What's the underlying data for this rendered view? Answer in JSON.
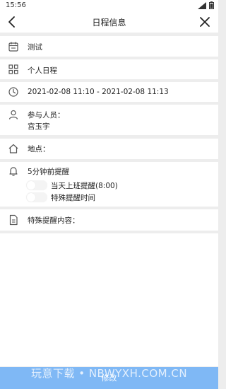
{
  "status_bar": {
    "time": "15:56"
  },
  "nav": {
    "title": "日程信息"
  },
  "schedule": {
    "name": "测试",
    "type": "个人日程",
    "time_range": "2021-02-08 11:10 - 2021-02-08 11:13",
    "participants_label": "参与人员：",
    "participants_value": "宫玉宇",
    "location_label": "地点：",
    "reminder": "5分钟前提醒",
    "reminder_options": [
      {
        "label": "当天上班提醒(8:00)",
        "on": false
      },
      {
        "label": "特殊提醒时间",
        "on": false
      }
    ],
    "special_content_label": "特殊提醒内容："
  },
  "bottom": {
    "button_label": "修改"
  },
  "watermark": "玩意下载 • NBWYXH.COM.CN",
  "colors": {
    "accent": "#7fb8f5",
    "background": "#ededed"
  }
}
